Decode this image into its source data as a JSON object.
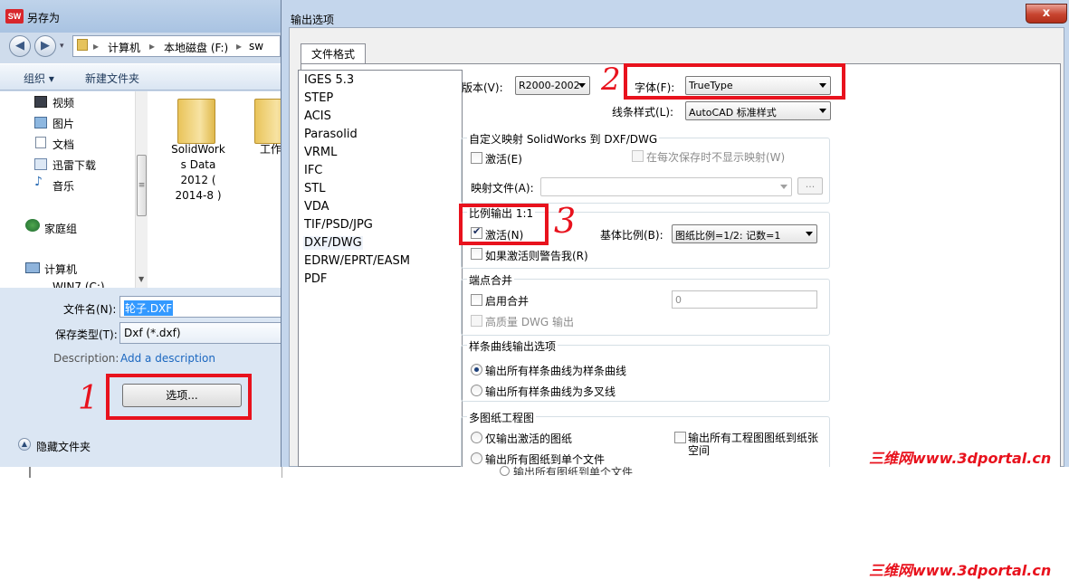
{
  "save_as": {
    "title": "另存为",
    "app_icon_text": "SW",
    "breadcrumb": [
      "计算机",
      "本地磁盘 (F:)",
      "sw"
    ],
    "toolbar": {
      "organize": "组织 ▾",
      "new_folder": "新建文件夹"
    },
    "nav_items": [
      "视频",
      "图片",
      "文档",
      "迅雷下载",
      "音乐",
      "家庭组",
      "计算机",
      "WIN7 (C:)"
    ],
    "files": [
      {
        "line1": "SolidWork",
        "line2": "s Data",
        "line3": "2012 (",
        "line4": "2014-8 )"
      },
      {
        "line1": "工作"
      }
    ],
    "file_name_label": "文件名(N):",
    "file_name_value": "轮子.DXF",
    "save_type_label": "保存类型(T):",
    "save_type_value": "Dxf (*.dxf)",
    "description_label": "Description:",
    "description_link": "Add a description",
    "options_button": "选项...",
    "hide_folders": "隐藏文件夹"
  },
  "dialog": {
    "title": "输出选项",
    "close_glyph": "x",
    "tab": "文件格式",
    "formats": [
      "IGES 5.3",
      "STEP",
      "ACIS",
      "Parasolid",
      "VRML",
      "IFC",
      "STL",
      "VDA",
      "TIF/PSD/JPG",
      "DXF/DWG",
      "EDRW/EPRT/EASM",
      "PDF"
    ],
    "selected_format": "DXF/DWG",
    "version_label": "版本(V):",
    "version_value": "R2000-2002",
    "font_label": "字体(F):",
    "font_value": "TrueType",
    "linestyle_label": "线条样式(L):",
    "linestyle_value": "AutoCAD 标准样式",
    "custom_map": {
      "title": "自定义映射 SolidWorks 到 DXF/DWG",
      "activate": "激活(E)",
      "no_show_map": "在每次保存时不显示映射(W)",
      "map_file_label": "映射文件(A):",
      "browse": "..."
    },
    "scale": {
      "title": "比例输出 1:1",
      "activate": "激活(N)",
      "warn": "如果激活则警告我(R)",
      "base_scale_label": "基体比例(B):",
      "base_scale_value": "图纸比例=1/2: 记数=1"
    },
    "endpoint_merge": {
      "title": "端点合并",
      "enable": "启用合并",
      "value": "0",
      "hq_dwg": "高质量 DWG 输出"
    },
    "spline": {
      "title": "样条曲线输出选项",
      "opt1": "输出所有样条曲线为样条曲线",
      "opt2": "输出所有样条曲线为多叉线"
    },
    "multi_sheet": {
      "title": "多图纸工程图",
      "opt1": "仅输出激活的图纸",
      "opt2": "输出所有图纸到单个文件",
      "opt3": "输出所有图纸到单个文件",
      "check_line1": "输出所有工程图图纸到纸张",
      "check_line2": "空间"
    }
  },
  "annotations": {
    "n1": "1",
    "n2": "2",
    "n3": "3"
  },
  "watermark": "三维网www.3dportal.cn",
  "colors": {
    "annotation_red": "#e8121d",
    "selection_blue": "#3399ff"
  }
}
